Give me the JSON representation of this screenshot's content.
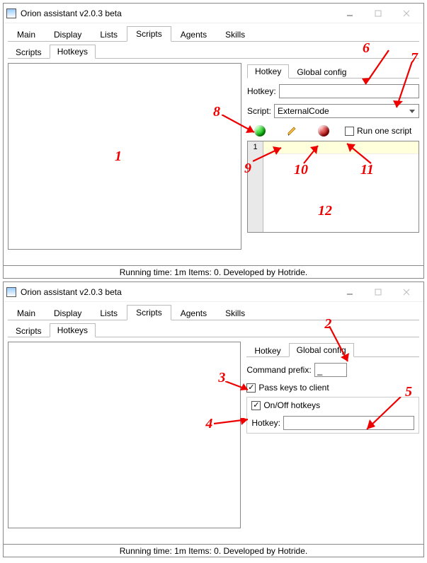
{
  "app": {
    "title": "Orion assistant v2.0.3 beta"
  },
  "main_tabs": [
    "Main",
    "Display",
    "Lists",
    "Scripts",
    "Agents",
    "Skills"
  ],
  "main_tabs_active_index": 3,
  "sub_tabs": [
    "Scripts",
    "Hotkeys"
  ],
  "sub_tabs_active_index": 1,
  "win1": {
    "inner_tabs": [
      "Hotkey",
      "Global config"
    ],
    "inner_tabs_active_index": 0,
    "hotkey_label": "Hotkey:",
    "hotkey_value": "",
    "script_label": "Script:",
    "script_value": "ExternalCode",
    "run_one_label": "Run one script",
    "run_one_checked": false,
    "grid_first_index": "1",
    "icons": {
      "play": "play-icon",
      "edit": "edit-icon",
      "stop": "stop-icon"
    }
  },
  "win2": {
    "inner_tabs": [
      "Hotkey",
      "Global config"
    ],
    "inner_tabs_active_index": 1,
    "command_prefix_label": "Command prefix:",
    "command_prefix_value": "_",
    "pass_keys_label": "Pass keys to client",
    "pass_keys_checked": true,
    "onoff_label": "On/Off hotkeys",
    "onoff_checked": true,
    "hotkey_label": "Hotkey:",
    "hotkey_value": ""
  },
  "status": "Running time: 1m Items: 0. Developed by Hotride.",
  "annotations": {
    "1": "1",
    "2": "2",
    "3": "3",
    "4": "4",
    "5": "5",
    "6": "6",
    "7": "7",
    "8": "8",
    "9": "9",
    "10": "10",
    "11": "11",
    "12": "12"
  }
}
